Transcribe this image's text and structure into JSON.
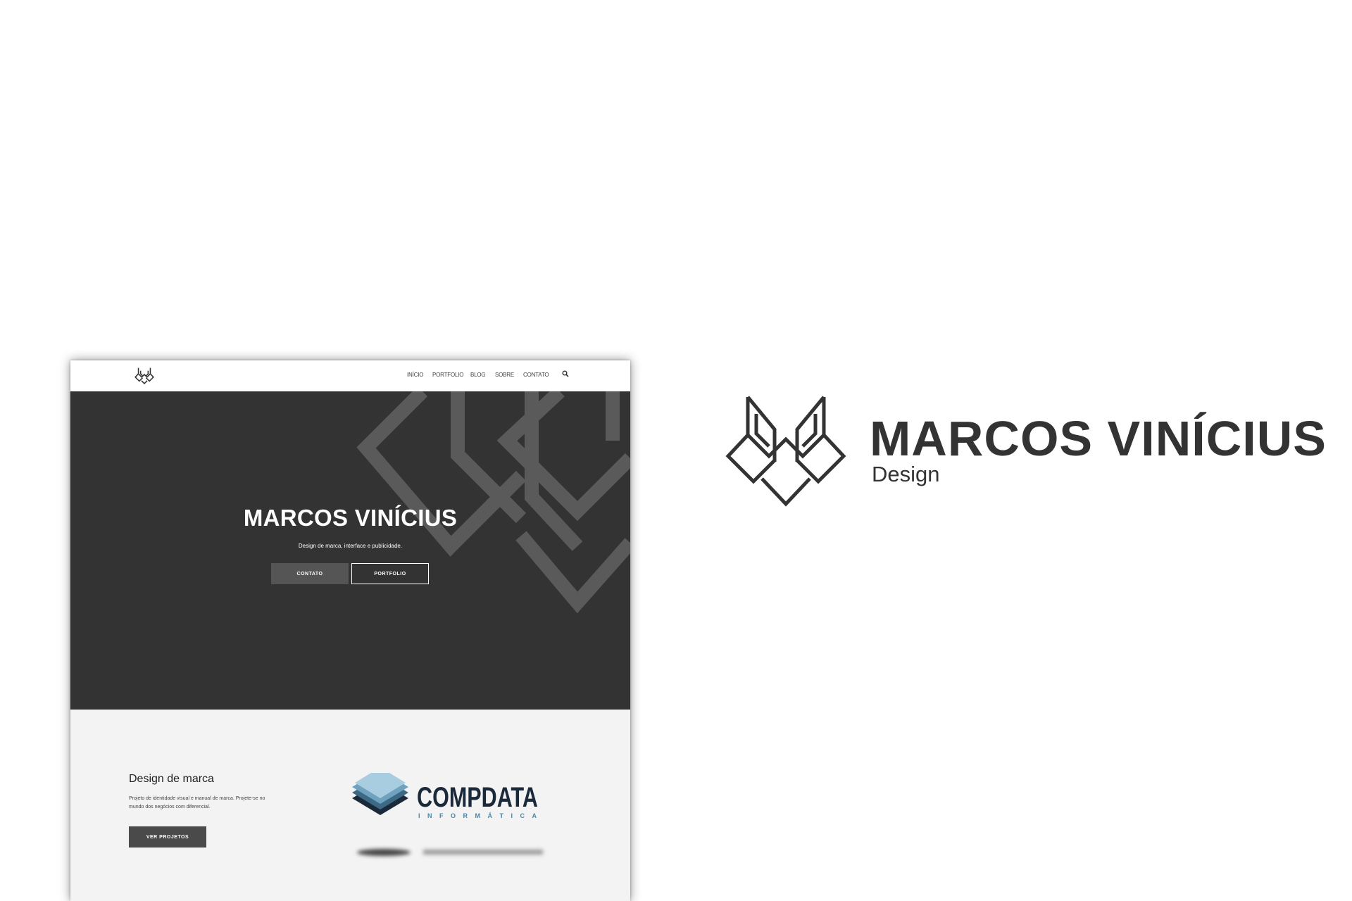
{
  "colors": {
    "hero_bg": "#333333",
    "accent_gray": "#555555",
    "section_bg": "#f3f3f3",
    "brand_text": "#333333",
    "compdata_navy": "#1b2a3a",
    "compdata_blue": "#4a86a8"
  },
  "nav": {
    "items": [
      "INÍCIO",
      "PORTFOLIO",
      "BLOG",
      "SOBRE",
      "CONTATO"
    ],
    "search_icon": "search-icon"
  },
  "hero": {
    "title": "MARCOS VINÍCIUS",
    "subtitle": "Design de marca, interface e publicidade.",
    "btn_contato": "CONTATO",
    "btn_portfolio": "PORTFOLIO"
  },
  "section": {
    "title": "Design de marca",
    "text": "Projeto de identidade visual e manual de marca. Projete-se no mundo dos negócios com diferencial.",
    "button": "VER PROJETOS"
  },
  "client_logo": {
    "name": "COMPDATA",
    "tagline": "INFORMÁTICA"
  },
  "brand": {
    "name": "MARCOS VINÍCIUS",
    "tagline": "Design"
  }
}
